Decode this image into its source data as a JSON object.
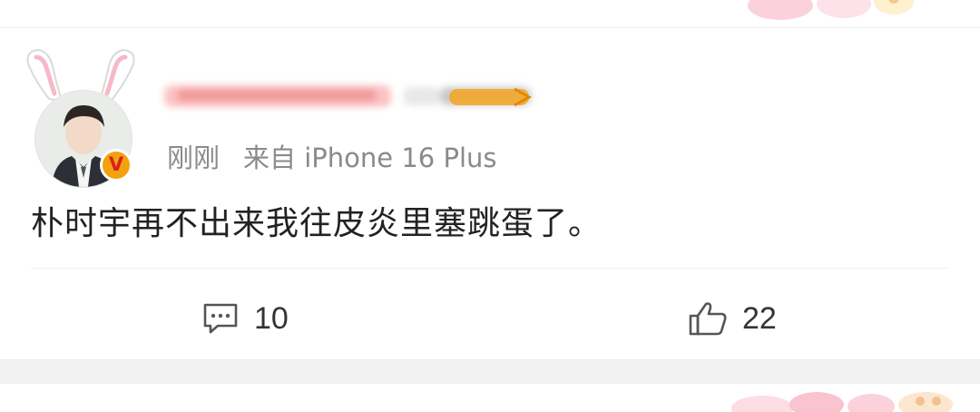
{
  "post": {
    "username": "",
    "timestamp": "刚刚",
    "source": "来自 iPhone 16 Plus",
    "content": "朴时宇再不出来我往皮炎里塞跳蛋了。",
    "verified_badge": "V"
  },
  "actions": {
    "comments_count": "10",
    "likes_count": "22"
  },
  "icons": {
    "comment": "comment-icon",
    "like": "thumbs-up-icon",
    "badge": "verified-v-icon"
  },
  "colors": {
    "meta_text": "#8a8a8a",
    "badge_bg": "#f3a10e",
    "badge_fg": "#d8201c",
    "username_orange": "#f5a623"
  }
}
